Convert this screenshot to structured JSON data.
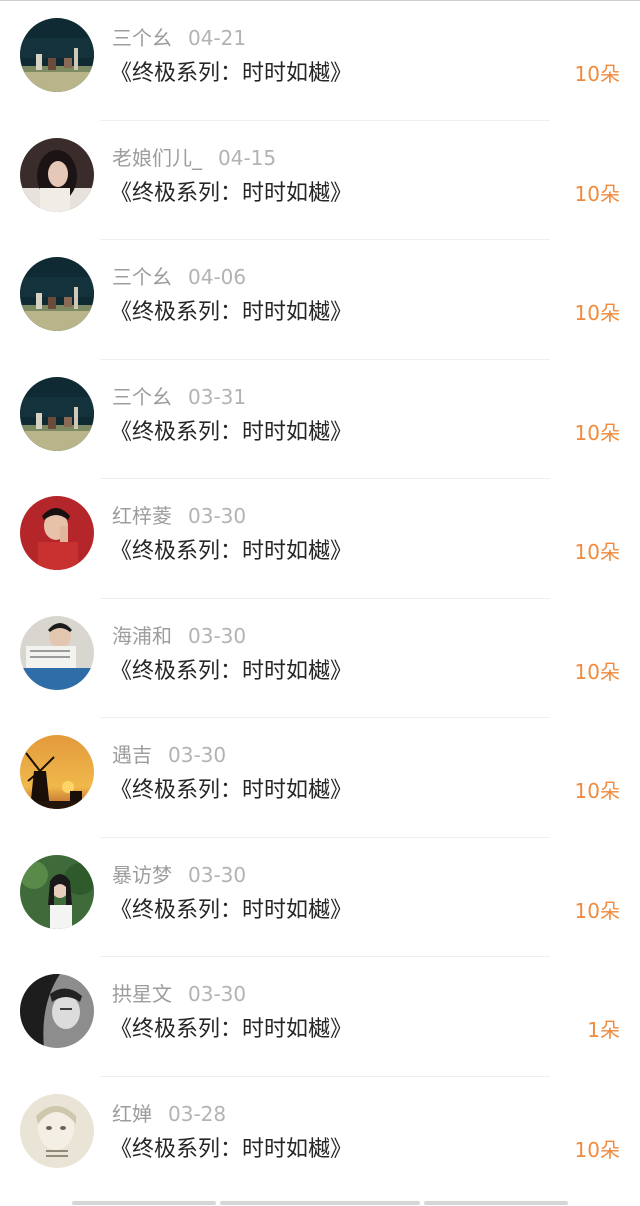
{
  "records": [
    {
      "username": "三个幺",
      "date": "04-21",
      "gift": "《终极系列：时时如樾》",
      "count": "10朵",
      "avatar": "night-field"
    },
    {
      "username": "老娘们儿_",
      "date": "04-15",
      "gift": "《终极系列：时时如樾》",
      "count": "10朵",
      "avatar": "girl-dark-hair"
    },
    {
      "username": "三个幺",
      "date": "04-06",
      "gift": "《终极系列：时时如樾》",
      "count": "10朵",
      "avatar": "night-field"
    },
    {
      "username": "三个幺",
      "date": "03-31",
      "gift": "《终极系列：时时如樾》",
      "count": "10朵",
      "avatar": "night-field"
    },
    {
      "username": "红梓菱",
      "date": "03-30",
      "gift": "《终极系列：时时如樾》",
      "count": "10朵",
      "avatar": "man-red-background"
    },
    {
      "username": "海浦和",
      "date": "03-30",
      "gift": "《终极系列：时时如樾》",
      "count": "10朵",
      "avatar": "man-newspaper"
    },
    {
      "username": "遇吉",
      "date": "03-30",
      "gift": "《终极系列：时时如樾》",
      "count": "10朵",
      "avatar": "windmill-sunset"
    },
    {
      "username": "暴访梦",
      "date": "03-30",
      "gift": "《终极系列：时时如樾》",
      "count": "10朵",
      "avatar": "girl-green-trees"
    },
    {
      "username": "拱星文",
      "date": "03-30",
      "gift": "《终极系列：时时如樾》",
      "count": "1朵",
      "avatar": "girl-grayscale"
    },
    {
      "username": "红婵",
      "date": "03-28",
      "gift": "《终极系列：时时如樾》",
      "count": "10朵",
      "avatar": "girl-soft-drawing"
    }
  ],
  "colors": {
    "username": "#9d9d9d",
    "date": "#b3b3b3",
    "gift_text": "#262626",
    "count": "#f08a3c",
    "divider": "#efefef"
  }
}
